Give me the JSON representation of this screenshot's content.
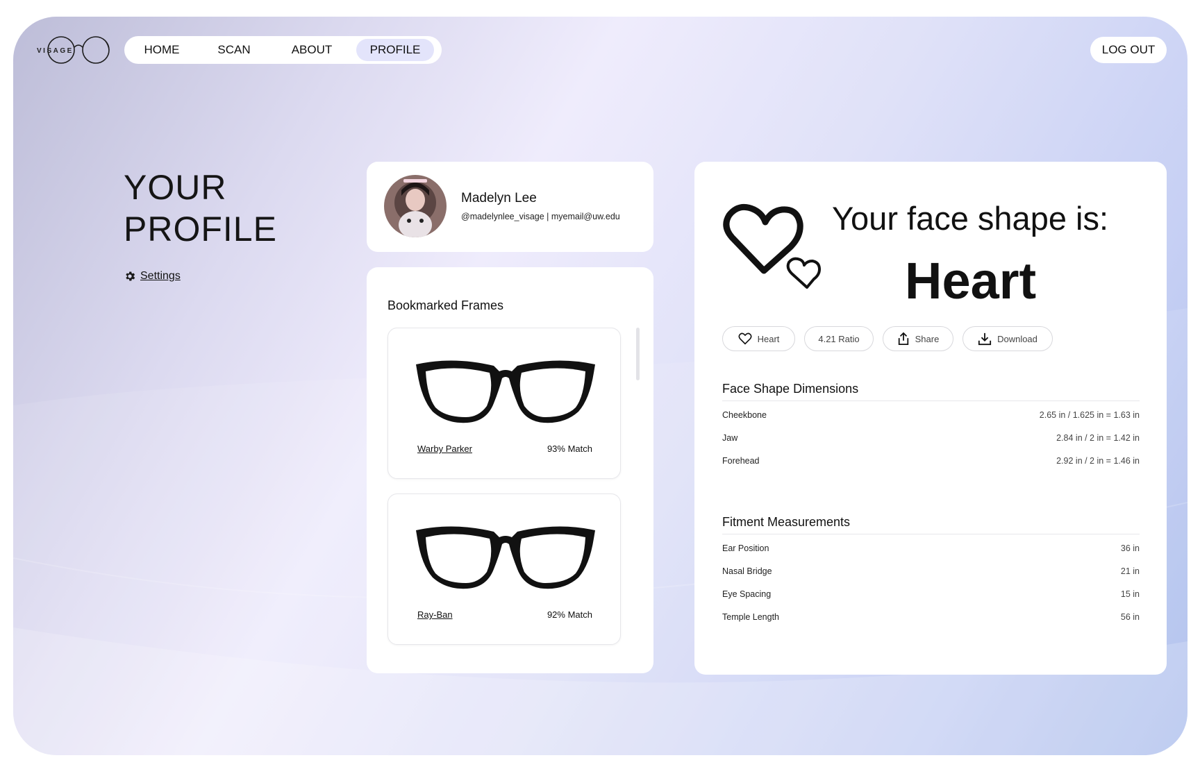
{
  "brand": {
    "logo_text": "VISAGE"
  },
  "nav": {
    "items": [
      {
        "label": "HOME"
      },
      {
        "label": "SCAN"
      },
      {
        "label": "ABOUT"
      },
      {
        "label": "PROFILE"
      }
    ],
    "active": "PROFILE",
    "logout_label": "LOG OUT"
  },
  "page": {
    "title": "YOUR\nPROFILE",
    "settings_label": "Settings"
  },
  "user": {
    "name": "Madelyn Lee",
    "meta": "@madelynlee_visage | myemail@uw.edu"
  },
  "bookmarks": {
    "title": "Bookmarked Frames",
    "frames": [
      {
        "brand": "Warby Parker",
        "match": "93% Match"
      },
      {
        "brand": "Ray-Ban",
        "match": "92% Match"
      }
    ]
  },
  "face": {
    "heading": "Your face shape is:",
    "shape": "Heart",
    "pills": [
      {
        "label": "Heart",
        "icon": "heart-outline-icon"
      },
      {
        "label": "4.21 Ratio",
        "icon": ""
      },
      {
        "label": "Share",
        "icon": "share-icon"
      },
      {
        "label": "Download",
        "icon": "download-icon"
      }
    ],
    "dimensions": {
      "title": "Face Shape Dimensions",
      "rows": [
        {
          "label": "Cheekbone",
          "value": "2.65 in / 1.625 in = 1.63 in"
        },
        {
          "label": "Jaw",
          "value": "2.84 in / 2 in = 1.42 in"
        },
        {
          "label": "Forehead",
          "value": "2.92 in / 2 in = 1.46 in"
        }
      ]
    },
    "fitment": {
      "title": "Fitment Measurements",
      "rows": [
        {
          "label": "Ear Position",
          "value": "36 in"
        },
        {
          "label": "Nasal Bridge",
          "value": "21 in"
        },
        {
          "label": "Eye Spacing",
          "value": "15 in"
        },
        {
          "label": "Temple Length",
          "value": "56 in"
        }
      ]
    }
  },
  "colors": {
    "accent_pill": "#e3e4fb",
    "text": "#111111",
    "card": "#ffffff"
  }
}
